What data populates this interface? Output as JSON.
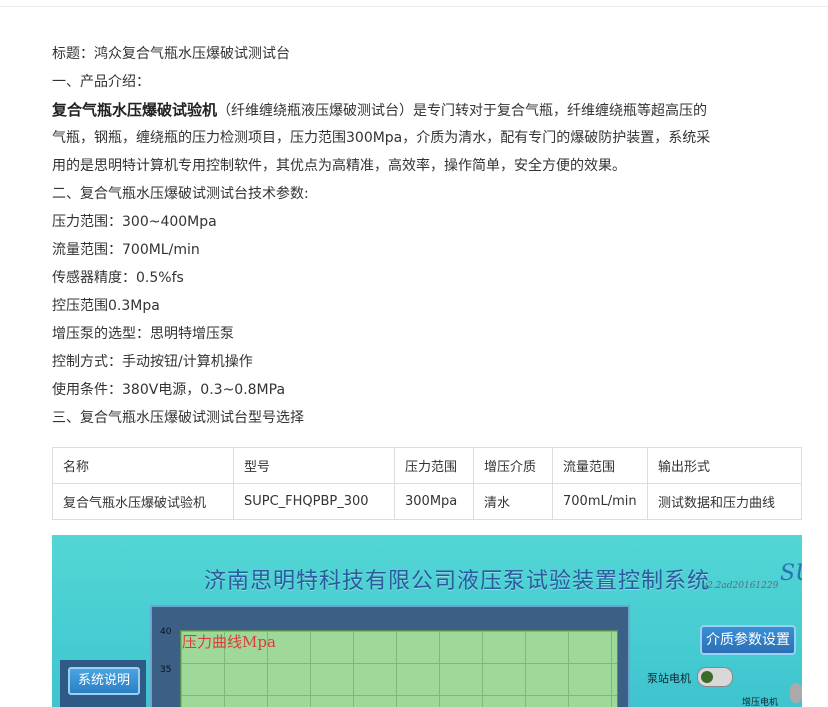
{
  "title_line": "标题：鸿众复合气瓶水压爆破试测试台",
  "sections": {
    "intro_heading": "一、产品介绍：",
    "intro_bold": "复合气瓶水压爆破试验机",
    "intro_text_1": "（纤维缠绕瓶液压爆破测试台）是专门转对于复合气瓶，纤维缠绕瓶等超高压的",
    "intro_text_2": "气瓶，钢瓶，缠绕瓶的压力检测项目，压力范围300Mpa，介质为清水，配有专门的爆破防护装置，系统采",
    "intro_text_3": "用的是思明特计算机专用控制软件，其优点为高精准，高效率，操作简单，安全方便的效果。",
    "params_heading": "二、复合气瓶水压爆破试测试台技术参数:",
    "params": [
      "压力范围：300~400Mpa",
      "流量范围：700ML/min",
      "传感器精度：0.5%fs",
      "控压范围0.3Mpa",
      "增压泵的选型：思明特增压泵",
      "控制方式：手动按钮/计算机操作",
      "使用条件：380V电源，0.3~0.8MPa"
    ],
    "models_heading": "三、复合气瓶水压爆破试测试台型号选择"
  },
  "table": {
    "headers": [
      "名称",
      "型号",
      "压力范围",
      "增压介质",
      "流量范围",
      "输出形式"
    ],
    "rows": [
      [
        "复合气瓶水压爆破试验机",
        "SUPC_FHQPBP_300",
        "300Mpa",
        "清水",
        "700mL/min",
        "测试数据和压力曲线"
      ]
    ]
  },
  "screenshot": {
    "title": "济南思明特科技有限公司液压泵试验装置控制系统",
    "version": "v2.2ad20161229",
    "brand_partial": "SU",
    "chart_label": "压力曲线Mpa",
    "tick_40": "40",
    "tick_35": "35",
    "btn_system": "系统说明",
    "btn_medium": "介质参数设置",
    "pump_label": "泵站电机",
    "pressurize_label": "增压电机"
  },
  "colors": {
    "screenshot_bg": "#4cd0d3",
    "title_blue": "#2c5a9e",
    "chart_green": "#9fd99a",
    "chart_label_red": "#e23a3a"
  }
}
